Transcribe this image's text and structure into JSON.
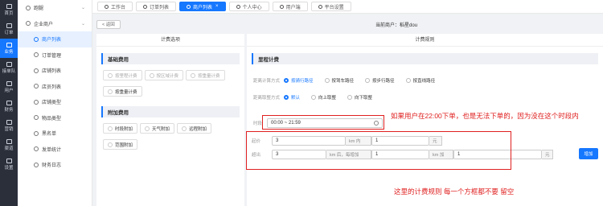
{
  "rail": [
    {
      "label": "首页",
      "icon": "home-icon"
    },
    {
      "label": "订单",
      "icon": "order-icon"
    },
    {
      "label": "业务",
      "icon": "business-icon"
    },
    {
      "label": "接单队",
      "icon": "team-icon"
    },
    {
      "label": "用户",
      "icon": "user-icon"
    },
    {
      "label": "财务",
      "icon": "finance-icon"
    },
    {
      "label": "营销",
      "icon": "marketing-icon"
    },
    {
      "label": "渠道",
      "icon": "channel-icon"
    },
    {
      "label": "设置",
      "icon": "settings-icon"
    }
  ],
  "sidebar": {
    "items": [
      {
        "label": "跑腿",
        "sub": false
      },
      {
        "label": "企业商户",
        "sub": false
      },
      {
        "label": "商户列表",
        "sub": true
      },
      {
        "label": "订单管理",
        "sub": true
      },
      {
        "label": "店铺列表",
        "sub": true
      },
      {
        "label": "店员列表",
        "sub": true
      },
      {
        "label": "店铺类型",
        "sub": true
      },
      {
        "label": "物品类型",
        "sub": true
      },
      {
        "label": "黑名单",
        "sub": true
      },
      {
        "label": "发单统计",
        "sub": true
      },
      {
        "label": "财务日志",
        "sub": true
      }
    ]
  },
  "tabs": [
    {
      "label": "工作台"
    },
    {
      "label": "订单列表"
    },
    {
      "label": "商户列表",
      "close": "×"
    },
    {
      "label": "个人中心"
    },
    {
      "label": "用户端"
    },
    {
      "label": "平台设置"
    }
  ],
  "topbar": {
    "back": "< 返回",
    "merchant_label": "当前商户：",
    "merchant_name": "稻星dou"
  },
  "left": {
    "title": "计费选项",
    "base_section": "基础费用",
    "base_chips": [
      "按里程计费",
      "按区域计费",
      "按重量计费"
    ],
    "base_extra": "按重量计费",
    "extra_section": "附加费用",
    "extra_chips": [
      "时段附加",
      "天气附加",
      "远程附加"
    ],
    "extra_chips2": [
      "范围附加"
    ]
  },
  "right": {
    "title": "计费规则",
    "section": "里程计费",
    "distance_calc_label": "距离计算方式",
    "distance_calc_options": [
      "按骑行路径",
      "按驾车路径",
      "按步行路径",
      "按直线路径"
    ],
    "distance_round_label": "距离取整方式",
    "distance_round_options": [
      "默认",
      "向上取整",
      "向下取整"
    ],
    "time_label": "时段",
    "time_value": "00:00 ~ 21:59",
    "start_label": "起价",
    "start_value": "3",
    "start_unit": "km 内",
    "start_price": "1",
    "start_price_unit": "元",
    "over_label": "超出",
    "over_value": "3",
    "over_unit": "km 后，每增加",
    "over_step": "1",
    "over_step_unit": "km 加",
    "over_price": "1",
    "over_price_unit": "元",
    "add_button": "增加"
  },
  "annotations": {
    "note1": "如果用户在22:00下单，也是无法下单的，因为没在这个时段内",
    "note2": "这里的计费规则  每一个方框都不要  留空"
  },
  "colors": {
    "accent": "#1677ff",
    "annotation": "#e02020",
    "rail": "#2b2f3a"
  }
}
